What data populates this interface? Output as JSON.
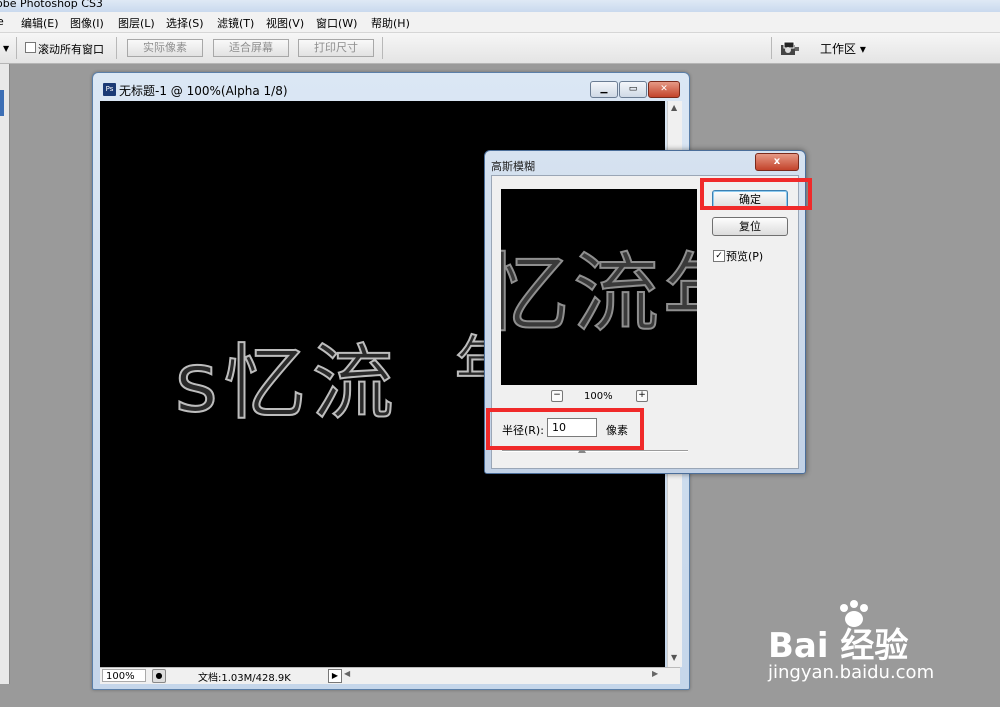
{
  "app": {
    "title": "obe Photoshop CS3"
  },
  "menu": [
    {
      "label": "e"
    },
    {
      "label": "编辑(E)"
    },
    {
      "label": "图像(I)"
    },
    {
      "label": "图层(L)"
    },
    {
      "label": "选择(S)"
    },
    {
      "label": "滤镜(T)"
    },
    {
      "label": "视图(V)"
    },
    {
      "label": "窗口(W)"
    },
    {
      "label": "帮助(H)"
    }
  ],
  "options_bar": {
    "scroll_all_label": "滚动所有窗口",
    "actual_pixels": "实际像素",
    "fit_screen": "适合屏幕",
    "print_size": "打印尺寸",
    "workspace": "工作区 ▾"
  },
  "document": {
    "title": "无标题-1 @ 100%(Alpha 1/8)",
    "ps_icon": "Ps",
    "canvas_text": "s忆流",
    "canvas_text_tail": "年",
    "zoom": "100%",
    "doc_size": "文档:1.03M/428.9K"
  },
  "dialog": {
    "title": "高斯模糊",
    "close": "x",
    "preview_text": "忆流年",
    "ok": "确定",
    "reset": "复位",
    "preview_label": "预览(P)",
    "preview_checked": true,
    "zoom_minus": "−",
    "zoom_plus": "+",
    "zoom": "100%",
    "radius_label": "半径(R):",
    "radius_value": "10",
    "unit": "像素"
  },
  "watermark": {
    "logo": "Bai  经验",
    "url": "jingyan.baidu.com"
  }
}
